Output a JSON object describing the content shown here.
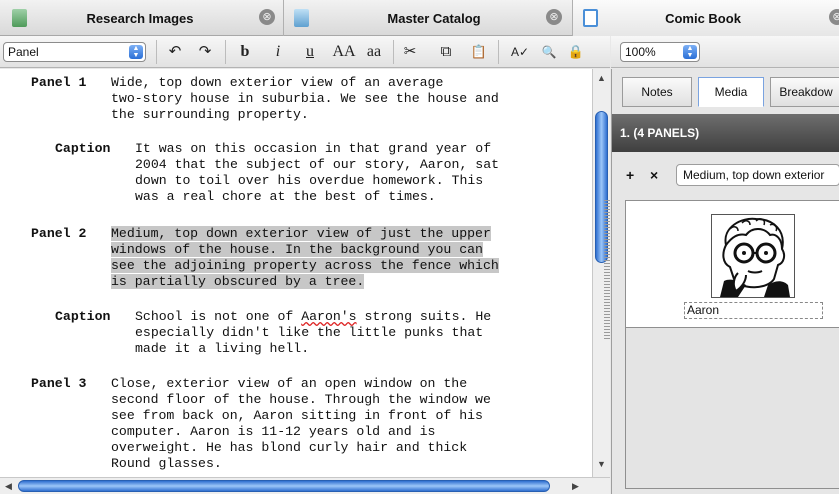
{
  "tabs": [
    {
      "label": "Research Images",
      "close": "⊗"
    },
    {
      "label": "Master Catalog",
      "close": "⊗"
    },
    {
      "label": "Comic Book",
      "close": "⊗"
    }
  ],
  "toolbar": {
    "style_select": "Panel",
    "undo": "↶",
    "redo": "↷",
    "bold": "b",
    "italic": "i",
    "underline": "u",
    "caps_upper": "AA",
    "caps_lower": "aa",
    "cut": "✂",
    "copy": "⧉",
    "paste": "📋",
    "spelling": "A✓",
    "find": "🔍",
    "lock": "🔒",
    "zoom": "100%"
  },
  "script": {
    "panel1": {
      "label": "Panel 1",
      "lines": [
        "Wide, top down exterior view of an average",
        "two-story house in suburbia. We see the house and",
        "the surrounding property."
      ]
    },
    "caption1": {
      "label": "Caption",
      "lines": [
        "It was on this occasion in that grand year of",
        "2004 that the subject of our story, Aaron, sat",
        "down to toil over his overdue homework. This",
        "was a real chore at the best of times."
      ]
    },
    "panel2": {
      "label": "Panel 2",
      "lines": [
        "Medium, top down exterior view of just the upper",
        "windows of the house. In the background you can",
        "see the adjoining property across the fence which",
        "is partially obscured by a tree."
      ]
    },
    "caption2": {
      "label": "Caption",
      "line1_a": "School is not one of ",
      "line1_b": "Aaron's",
      "line1_c": " strong suits. He",
      "lines": [
        "especially didn't like the little punks that",
        "made it a living hell."
      ]
    },
    "panel3": {
      "label": "Panel 3",
      "lines": [
        "Close, exterior view of an open window on the",
        "second floor of the house. Through the window we",
        "see from back on, Aaron sitting in front of his",
        "computer. Aaron is 11-12 years old and is",
        "overweight. He has blond curly hair and thick",
        "Round glasses."
      ]
    }
  },
  "inspector": {
    "tabs": [
      "Notes",
      "Media",
      "Breakdow"
    ],
    "active_tab": "Media",
    "scene_title": "1. (4 PANELS)",
    "add": "+",
    "remove": "×",
    "media_field": "Medium, top down exterior",
    "image_caption": "Aaron"
  },
  "colors": {
    "scrollbar_accent": "#2f6fd0",
    "highlight": "#c7c7c7",
    "scene_bar": "#4a4a4a"
  }
}
